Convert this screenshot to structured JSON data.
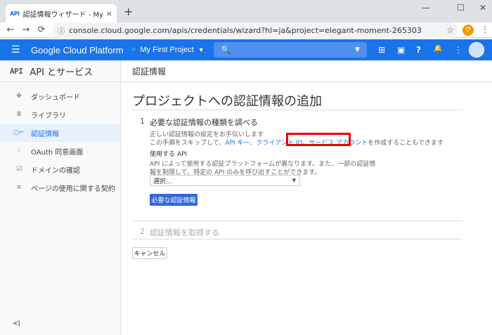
{
  "browser": {
    "tab_favicon": "API",
    "tab_title": "認証情報ウィザード - My First Proje",
    "tab_close": "×",
    "new_tab": "+",
    "window_controls": [
      "—",
      "☐",
      "✕"
    ],
    "nav": {
      "back": "←",
      "forward": "→",
      "reload": "⟳"
    },
    "url": "console.cloud.google.com/apis/credentials/wizard?hl=ja&project=elegant-moment-265303",
    "bookmark_star": "☆",
    "profile_badge": "ク",
    "menu": "⋮"
  },
  "gcp_header": {
    "menu_icon": "☰",
    "brand": "Google Cloud Platform",
    "project": "My First Project",
    "project_icon": "⁘",
    "caret": "▼",
    "search_icon": "🔍",
    "icons": [
      "gift-icon",
      "terminal-icon",
      "help-icon",
      "notifications-icon",
      "more-vert-icon"
    ],
    "icon_glyphs": [
      "⊞",
      "▣",
      "?",
      "🔔",
      "⋮"
    ],
    "accent_color": "#1a73e8"
  },
  "sidebar": {
    "logo": "API",
    "title": "API とサービス",
    "items": [
      {
        "icon": "dashboard-icon",
        "glyph": "✥",
        "label": "ダッシュボード",
        "active": false
      },
      {
        "icon": "library-icon",
        "glyph": "Ⅲ",
        "label": "ライブラリ",
        "active": false
      },
      {
        "icon": "key-icon",
        "glyph": "○⌐",
        "label": "認証情報",
        "active": true
      },
      {
        "icon": "consent-icon",
        "glyph": "⁙",
        "label": "OAuth 同意画面",
        "active": false
      },
      {
        "icon": "domain-icon",
        "glyph": "☑",
        "label": "ドメインの確認",
        "active": false
      },
      {
        "icon": "settings-list-icon",
        "glyph": "≡",
        "label": "ページの使用に関する契約",
        "active": false
      }
    ],
    "collapse": "<|"
  },
  "main": {
    "header": "認証情報",
    "title": "プロジェクトへの認証情報の追加",
    "step1": {
      "num": "1",
      "title": "必要な認証情報の種類を調べる",
      "desc1": "正しい認証情報の設定をお手伝いします",
      "desc2_prefix": "この手順をスキップして、",
      "link_api_key": "API キー",
      "sep1": "、",
      "link_client_id": "クライアント ID",
      "sep2": "、",
      "link_service_account": "サービス アカウント",
      "desc2_suffix": "を作成することもできます",
      "api_label": "使用する API",
      "api_desc1": "API によって使用する認証プラットフォームが異なります。また、一部の認証情",
      "api_desc2": "報を制限して、特定の API のみを呼び出すことができます。",
      "select_value": "選択...",
      "select_caret": "▼",
      "button": "必要な認証情報"
    },
    "step2": {
      "num": "2",
      "title": "認証情報を取得する"
    },
    "cancel": "キャンセル"
  }
}
